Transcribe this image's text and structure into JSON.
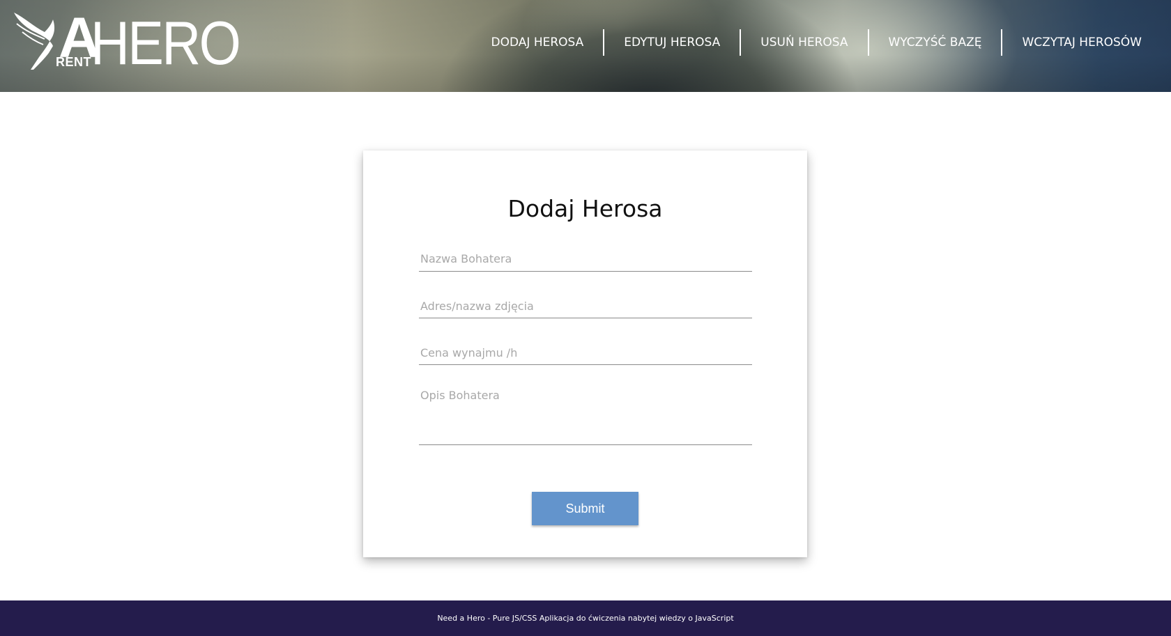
{
  "logo": {
    "letter": "A",
    "small": "RENT",
    "big": "HERO",
    "icon": "winged-figure-icon"
  },
  "nav": {
    "items": [
      {
        "label": "DODAJ HEROSA"
      },
      {
        "label": "EDYTUJ HEROSA"
      },
      {
        "label": "USUŃ HEROSA"
      },
      {
        "label": "WYCZYŚĆ BAZĘ"
      },
      {
        "label": "WCZYTAJ HEROSÓW"
      }
    ]
  },
  "form": {
    "title": "Dodaj Herosa",
    "name_placeholder": "Nazwa Bohatera",
    "name_value": "",
    "image_placeholder": "Adres/nazwa zdjęcia",
    "image_value": "",
    "price_placeholder": "Cena wynajmu /h",
    "price_value": "",
    "description_placeholder": "Opis Bohatera",
    "description_value": "",
    "submit_label": "Submit"
  },
  "footer": {
    "text": "Need a Hero - Pure JS/CSS Aplikacja do ćwiczenia nabytej wiedzy o JavaScript"
  },
  "colors": {
    "submit_bg": "#6394cc",
    "footer_bg": "#241c4c",
    "nav_text": "#ffffff"
  }
}
